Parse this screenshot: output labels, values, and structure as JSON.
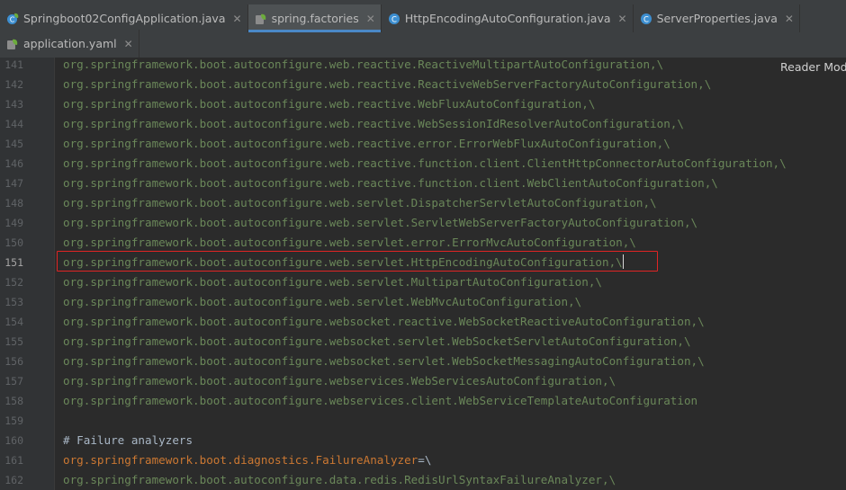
{
  "tabs_row1": [
    {
      "label": "Springboot02ConfigApplication.java",
      "icon": "spring-class-icon",
      "active": false
    },
    {
      "label": "spring.factories",
      "icon": "spring-factories-icon",
      "active": true
    },
    {
      "label": "HttpEncodingAutoConfiguration.java",
      "icon": "class-icon",
      "active": false
    },
    {
      "label": "ServerProperties.java",
      "icon": "class-icon",
      "active": false
    }
  ],
  "tabs_row2": [
    {
      "label": "application.yaml",
      "icon": "yaml-icon",
      "active": false
    }
  ],
  "reader_mode": "Reader Mod",
  "current_line": "151",
  "lines": [
    {
      "n": "141",
      "text": "org.springframework.boot.autoconfigure.web.reactive.ReactiveMultipartAutoConfiguration,\\"
    },
    {
      "n": "142",
      "text": "org.springframework.boot.autoconfigure.web.reactive.ReactiveWebServerFactoryAutoConfiguration,\\"
    },
    {
      "n": "143",
      "text": "org.springframework.boot.autoconfigure.web.reactive.WebFluxAutoConfiguration,\\"
    },
    {
      "n": "144",
      "text": "org.springframework.boot.autoconfigure.web.reactive.WebSessionIdResolverAutoConfiguration,\\"
    },
    {
      "n": "145",
      "text": "org.springframework.boot.autoconfigure.web.reactive.error.ErrorWebFluxAutoConfiguration,\\"
    },
    {
      "n": "146",
      "text": "org.springframework.boot.autoconfigure.web.reactive.function.client.ClientHttpConnectorAutoConfiguration,\\"
    },
    {
      "n": "147",
      "text": "org.springframework.boot.autoconfigure.web.reactive.function.client.WebClientAutoConfiguration,\\"
    },
    {
      "n": "148",
      "text": "org.springframework.boot.autoconfigure.web.servlet.DispatcherServletAutoConfiguration,\\"
    },
    {
      "n": "149",
      "text": "org.springframework.boot.autoconfigure.web.servlet.ServletWebServerFactoryAutoConfiguration,\\"
    },
    {
      "n": "150",
      "text": "org.springframework.boot.autoconfigure.web.servlet.error.ErrorMvcAutoConfiguration,\\"
    },
    {
      "n": "151",
      "text": "org.springframework.boot.autoconfigure.web.servlet.HttpEncodingAutoConfiguration,\\"
    },
    {
      "n": "152",
      "text": "org.springframework.boot.autoconfigure.web.servlet.MultipartAutoConfiguration,\\"
    },
    {
      "n": "153",
      "text": "org.springframework.boot.autoconfigure.web.servlet.WebMvcAutoConfiguration,\\"
    },
    {
      "n": "154",
      "text": "org.springframework.boot.autoconfigure.websocket.reactive.WebSocketReactiveAutoConfiguration,\\"
    },
    {
      "n": "155",
      "text": "org.springframework.boot.autoconfigure.websocket.servlet.WebSocketServletAutoConfiguration,\\"
    },
    {
      "n": "156",
      "text": "org.springframework.boot.autoconfigure.websocket.servlet.WebSocketMessagingAutoConfiguration,\\"
    },
    {
      "n": "157",
      "text": "org.springframework.boot.autoconfigure.webservices.WebServicesAutoConfiguration,\\"
    },
    {
      "n": "158",
      "text": "org.springframework.boot.autoconfigure.webservices.client.WebServiceTemplateAutoConfiguration"
    },
    {
      "n": "159",
      "text": ""
    },
    {
      "n": "160",
      "text": "# Failure analyzers",
      "kind": "comment"
    },
    {
      "n": "161",
      "key": "org.springframework.boot.diagnostics.FailureAnalyzer",
      "eq": "=\\",
      "kind": "key"
    },
    {
      "n": "162",
      "text": "org.springframework.boot.autoconfigure.data.redis.RedisUrlSyntaxFailureAnalyzer,\\"
    }
  ],
  "colors": {
    "value": "#6a8759",
    "key": "#cc7832",
    "plain": "#a9b7c6",
    "highlight_box": "#e02424",
    "active_tab_underline": "#4a88c7"
  }
}
